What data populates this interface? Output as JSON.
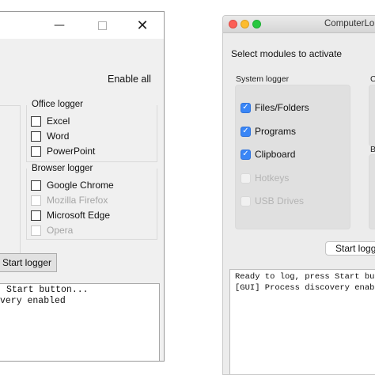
{
  "windows_app": {
    "title_controls": {
      "minimize": "—",
      "close": "✕"
    },
    "enable_all_label": "Enable all",
    "office_logger": {
      "title": "Office logger",
      "items": [
        {
          "label": "Excel",
          "checked": false,
          "enabled": true
        },
        {
          "label": "Word",
          "checked": false,
          "enabled": true
        },
        {
          "label": "PowerPoint",
          "checked": false,
          "enabled": true
        }
      ]
    },
    "browser_logger": {
      "title": "Browser logger",
      "items": [
        {
          "label": "Google Chrome",
          "checked": false,
          "enabled": true
        },
        {
          "label": "Mozilla Firefox",
          "checked": false,
          "enabled": false
        },
        {
          "label": "Microsoft Edge",
          "checked": false,
          "enabled": true
        },
        {
          "label": "Opera",
          "checked": false,
          "enabled": false
        }
      ]
    },
    "start_button_label": "Start logger",
    "log_lines": [
      "Start button...",
      "very enabled"
    ]
  },
  "mac_app": {
    "title": "ComputerLo",
    "heading": "Select modules to activate",
    "system_logger": {
      "title": "System logger",
      "items": [
        {
          "label": "Files/Folders",
          "checked": true,
          "enabled": true
        },
        {
          "label": "Programs",
          "checked": true,
          "enabled": true
        },
        {
          "label": "Clipboard",
          "checked": true,
          "enabled": true
        },
        {
          "label": "Hotkeys",
          "checked": false,
          "enabled": false
        },
        {
          "label": "USB Drives",
          "checked": false,
          "enabled": false
        }
      ]
    },
    "second_group_title": "C",
    "third_group_title": "B",
    "start_button_label": "Start logg",
    "log_lines": [
      "Ready to log, press Start butto",
      "[GUI] Process discovery enabled"
    ],
    "checkmark": "✓"
  },
  "colors": {
    "mac_checkbox_blue": "#3a86f6",
    "mac_close": "#fc5f57",
    "mac_minimize": "#fdbc2e",
    "mac_zoom": "#28c840"
  }
}
